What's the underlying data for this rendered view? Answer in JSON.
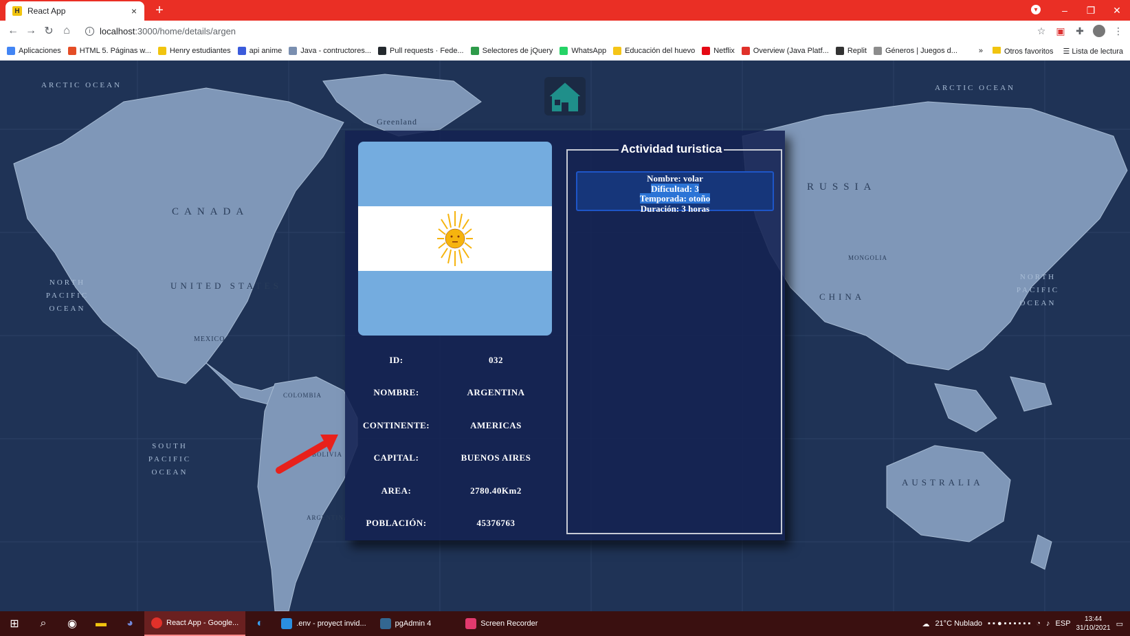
{
  "browser": {
    "tab_title": "React App",
    "tab_close": "×",
    "new_tab": "+",
    "url_host": "localhost",
    "url_path": ":3000/home/details/argen",
    "window_controls": [
      "–",
      "❐",
      "✕"
    ]
  },
  "bookmarks": [
    {
      "label": "Aplicaciones",
      "icon": "apps-grid-icon",
      "color": "#4285f4"
    },
    {
      "label": "HTML 5. Páginas w...",
      "icon": "html-icon",
      "color": "#e44d26"
    },
    {
      "label": "Henry estudiantes",
      "icon": "henry-icon",
      "color": "#f1c40f"
    },
    {
      "label": "api anime",
      "icon": "api-icon",
      "color": "#3b5bdb"
    },
    {
      "label": "Java - contructores...",
      "icon": "java-icon",
      "color": "#7a8fb0"
    },
    {
      "label": "Pull requests · Fede...",
      "icon": "github-icon",
      "color": "#24292e"
    },
    {
      "label": "Selectores de jQuery",
      "icon": "jquery-icon",
      "color": "#2e9b4a"
    },
    {
      "label": "WhatsApp",
      "icon": "whatsapp-icon",
      "color": "#25d366"
    },
    {
      "label": "Educación del huevo",
      "icon": "egg-icon",
      "color": "#f5c518"
    },
    {
      "label": "Netflix",
      "icon": "netflix-icon",
      "color": "#e50914"
    },
    {
      "label": "Overview (Java Platf...",
      "icon": "oracle-icon",
      "color": "#e0312a"
    },
    {
      "label": "Replit",
      "icon": "replit-icon",
      "color": "#333333"
    },
    {
      "label": "Géneros | Juegos d...",
      "icon": "games-icon",
      "color": "#8c8c8c"
    }
  ],
  "bookmarks_more": "»",
  "bookmarks_other": "Otros favoritos",
  "bookmarks_reading": "Lista de lectura",
  "map_labels": {
    "arctic_left": "ARCTIC OCEAN",
    "arctic_right": "ARCTIC OCEAN",
    "greenland": "Greenland",
    "canada": "CANADA",
    "united_states": "UNITED STATES",
    "russia": "RUSSIA",
    "china": "CHINA",
    "mongolia": "MONGOLIA",
    "north_pacific_left": "NORTH PACIFIC OCEAN",
    "north_pacific_right": "NORTH PACIFIC OCEAN",
    "south_pacific": "SOUTH PACIFIC OCEAN",
    "australia": "AUSTRALIA",
    "colombia": "COLOMBIA",
    "bolivia": "BOLIVIA",
    "argentina": "ARGENTINA",
    "mexico": "MEXICO"
  },
  "country": {
    "fields": [
      {
        "label": "ID:",
        "value": "032"
      },
      {
        "label": "NOMBRE:",
        "value": "ARGENTINA"
      },
      {
        "label": "CONTINENTE:",
        "value": "AMERICAS"
      },
      {
        "label": "CAPITAL:",
        "value": "BUENOS AIRES"
      },
      {
        "label": "AREA:",
        "value": "2780.40Km2"
      },
      {
        "label": "POBLACIÓN:",
        "value": "45376763"
      }
    ],
    "flag_colors": {
      "sky": "#74acdf",
      "white": "#ffffff",
      "sun": "#f6b40e"
    }
  },
  "activity": {
    "title": "Actividad turistica",
    "items": [
      {
        "nombre": "Nombre: volar",
        "dificultad": "Dificultad: 3",
        "temporada": "Temporada: otoño",
        "duracion": "Duración: 3 horas"
      }
    ]
  },
  "taskbar": {
    "apps": [
      {
        "label": "React App - Google...",
        "active": true
      },
      {
        "label": ".env - proyect invid...",
        "active": false
      },
      {
        "label": "pgAdmin 4",
        "active": false
      },
      {
        "label": "Screen Recorder",
        "active": false
      }
    ],
    "weather": "21°C  Nublado",
    "language": "ESP",
    "time": "13:44",
    "date": "31/10/2021"
  },
  "colors": {
    "chrome_red": "#ea2f25",
    "card_bg": "#142252",
    "activity_highlight": "#2b74d6",
    "taskbar": "#3a1010"
  }
}
